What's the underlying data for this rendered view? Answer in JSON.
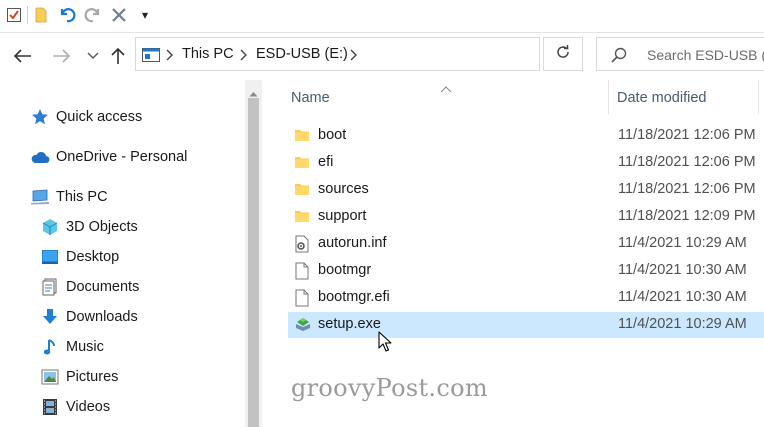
{
  "toolbar": {
    "customize_arrow": "▾"
  },
  "address_bar": {
    "crumbs": [
      "This PC",
      "ESD-USB (E:)"
    ]
  },
  "search": {
    "placeholder": "Search ESD-USB (E:)"
  },
  "sidebar": {
    "items": [
      {
        "label": "Quick access",
        "icon": "star-icon"
      },
      {
        "label": "OneDrive - Personal",
        "icon": "cloud-icon"
      },
      {
        "label": "This PC",
        "icon": "computer-icon"
      },
      {
        "label": "3D Objects",
        "icon": "cube-icon"
      },
      {
        "label": "Desktop",
        "icon": "desktop-icon"
      },
      {
        "label": "Documents",
        "icon": "documents-icon"
      },
      {
        "label": "Downloads",
        "icon": "download-arrow-icon"
      },
      {
        "label": "Music",
        "icon": "music-note-icon"
      },
      {
        "label": "Pictures",
        "icon": "pictures-icon"
      },
      {
        "label": "Videos",
        "icon": "film-icon"
      }
    ]
  },
  "columns": {
    "name": "Name",
    "date_modified": "Date modified"
  },
  "files": [
    {
      "name": "boot",
      "date": "11/18/2021 12:06 PM",
      "type": "folder"
    },
    {
      "name": "efi",
      "date": "11/18/2021 12:06 PM",
      "type": "folder"
    },
    {
      "name": "sources",
      "date": "11/18/2021 12:06 PM",
      "type": "folder"
    },
    {
      "name": "support",
      "date": "11/18/2021 12:09 PM",
      "type": "folder"
    },
    {
      "name": "autorun.inf",
      "date": "11/4/2021 10:29 AM",
      "type": "settings-file"
    },
    {
      "name": "bootmgr",
      "date": "11/4/2021 10:30 AM",
      "type": "file"
    },
    {
      "name": "bootmgr.efi",
      "date": "11/4/2021 10:30 AM",
      "type": "file"
    },
    {
      "name": "setup.exe",
      "date": "11/4/2021 10:29 AM",
      "type": "setup-exe",
      "selected": true
    }
  ],
  "watermark": "groovyPost.com",
  "colors": {
    "folder": "#f8cd55",
    "selection": "#cce8ff",
    "accent_blue": "#1979ca"
  }
}
